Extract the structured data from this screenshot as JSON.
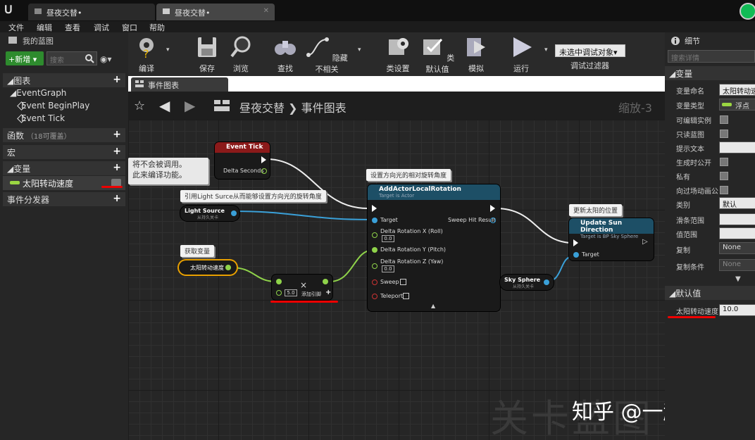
{
  "window": {
    "tab1_title": "昼夜交替•",
    "tab2_title": "昼夜交替•"
  },
  "menu": [
    "文件",
    "编辑",
    "查看",
    "调试",
    "窗口",
    "帮助"
  ],
  "left_panel": {
    "title": "我的蓝图",
    "new_button": "+新增 ▾",
    "search_placeholder": "搜索",
    "graph_section": "◢图表",
    "event_graph": "◢EventGraph",
    "event_beginplay": "Event BeginPlay",
    "event_tick": "Event Tick",
    "functions_section": "函数",
    "functions_count": "（18可覆盖）",
    "macros_section": "宏",
    "variables_section": "◢变量",
    "variable_item": "太阳转动速度",
    "dispatchers_section": "事件分发器"
  },
  "toolbar": {
    "compile": "编译",
    "save": "保存",
    "browse": "浏览",
    "find": "查找",
    "hide_unrelated": "隐藏不相关",
    "class_settings": "类设置",
    "class_defaults": "类默认值",
    "simulate": "模拟",
    "play": "运行",
    "debug_dropdown": "未选中调试对象▾",
    "debug_filter": "调试过滤器"
  },
  "graph": {
    "tab_title": "事件图表",
    "breadcrumb_bp": "昼夜交替",
    "breadcrumb_sep": "❯",
    "breadcrumb_graph": "事件图表",
    "zoom": "缩放-3",
    "watermark_bg": "关卡蓝图",
    "watermark": "知乎 @一起学习"
  },
  "nodes": {
    "event_tick": {
      "title": "Event Tick",
      "pin": "Delta Seconds"
    },
    "warning_comment_line1": "将不会被调用。",
    "warning_comment_line2": "此来编译功能。",
    "comment_set_rotation": "设置方向光的相对旋转角度",
    "comment_ref_light": "引用Light Surce从而能够设置方向光的旋转角度",
    "comment_get_var": "获取变量",
    "comment_update_sun": "更新太阳的位置",
    "light_source": {
      "title": "Light Source",
      "sub": "从持久关卡"
    },
    "add_rotation": {
      "title": "AddActorLocalRotation",
      "sub": "Target is Actor",
      "target": "Target",
      "sweep_hit": "Sweep Hit Result",
      "rx": "Delta Rotation X (Roll)",
      "ry": "Delta Rotation Y (Pitch)",
      "rz": "Delta Rotation Z (Yaw)",
      "rx_val": "0.0",
      "rz_val": "0.0",
      "sweep": "Sweep",
      "teleport": "Teleport"
    },
    "var_getter": "太阳转动速度",
    "multiply": {
      "value": "5.0",
      "add_pin": "添加引脚"
    },
    "sky_sphere": {
      "title": "Sky Sphere",
      "sub": "从持久关卡"
    },
    "update_sun": {
      "title": "Update Sun Direction",
      "sub": "Target is BP Sky Sphere",
      "target": "Target"
    }
  },
  "details": {
    "title": "细节",
    "search_placeholder": "搜索详情",
    "variable_section": "◢变量",
    "rows": {
      "var_name_label": "变量命名",
      "var_name_value": "太阳转动速度",
      "var_type_label": "变量类型",
      "var_type_value": "浮点",
      "editable_label": "可编辑实例",
      "readonly_label": "只读蓝图",
      "tooltip_label": "提示文本",
      "expose_label": "生成时公开",
      "private_label": "私有",
      "cinematic_label": "向过场动画公",
      "category_label": "类别",
      "category_value": "默认",
      "slider_label": "滑条范围",
      "value_range_label": "值范围",
      "replication_label": "复制",
      "replication_value": "None",
      "rep_cond_label": "复制条件",
      "rep_cond_value": "None"
    },
    "defaults_section": "◢默认值",
    "default_var_label": "太阳转动速度",
    "default_var_value": "10.0"
  }
}
